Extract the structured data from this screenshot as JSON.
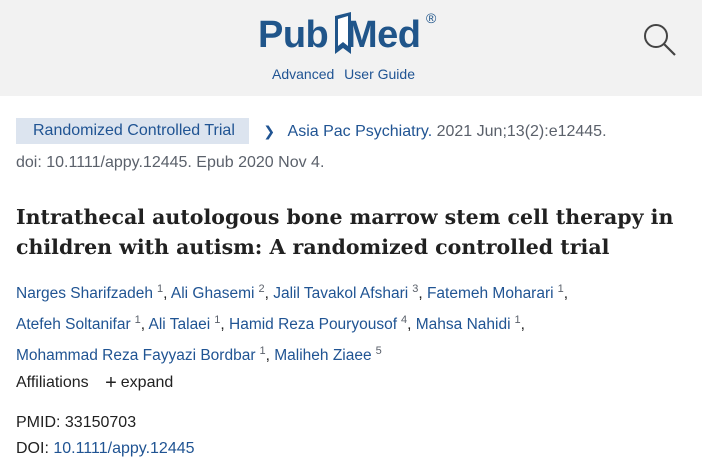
{
  "header": {
    "logo_pub": "Pub",
    "logo_med": "Med",
    "logo_reg": "®",
    "advanced_link": "Advanced",
    "user_guide_link": "User Guide",
    "search_icon": "search-icon",
    "brand_color": "#20558a",
    "background": "#f2f2f2"
  },
  "article": {
    "type_badge": "Randomized Controlled Trial",
    "journal": "Asia Pac Psychiatry.",
    "citation_details": "2021 Jun;13(2):e12445.",
    "doi_epub": "doi: 10.1111/appy.12445. Epub 2020 Nov 4.",
    "title": "Intrathecal autologous bone marrow stem cell therapy in children with autism: A randomized controlled trial",
    "authors": [
      {
        "name": "Narges Sharifzadeh",
        "aff": "1"
      },
      {
        "name": "Ali Ghasemi",
        "aff": "2"
      },
      {
        "name": "Jalil Tavakol Afshari",
        "aff": "3"
      },
      {
        "name": "Fatemeh Moharari",
        "aff": "1"
      },
      {
        "name": "Atefeh Soltanifar",
        "aff": "1"
      },
      {
        "name": "Ali Talaei",
        "aff": "1"
      },
      {
        "name": "Hamid Reza Pouryousof",
        "aff": "4"
      },
      {
        "name": "Mahsa Nahidi",
        "aff": "1"
      },
      {
        "name": "Mohammad Reza Fayyazi Bordbar",
        "aff": "1"
      },
      {
        "name": "Maliheh Ziaee",
        "aff": "5"
      }
    ],
    "affiliations_label": "Affiliations",
    "expand_label": "expand",
    "pmid_label": "PMID:",
    "pmid_value": "33150703",
    "doi_label": "DOI:",
    "doi_value": "10.1111/appy.12445"
  },
  "colors": {
    "link": "#205493",
    "badge_bg": "#dce4ef",
    "muted": "#5b616b"
  }
}
